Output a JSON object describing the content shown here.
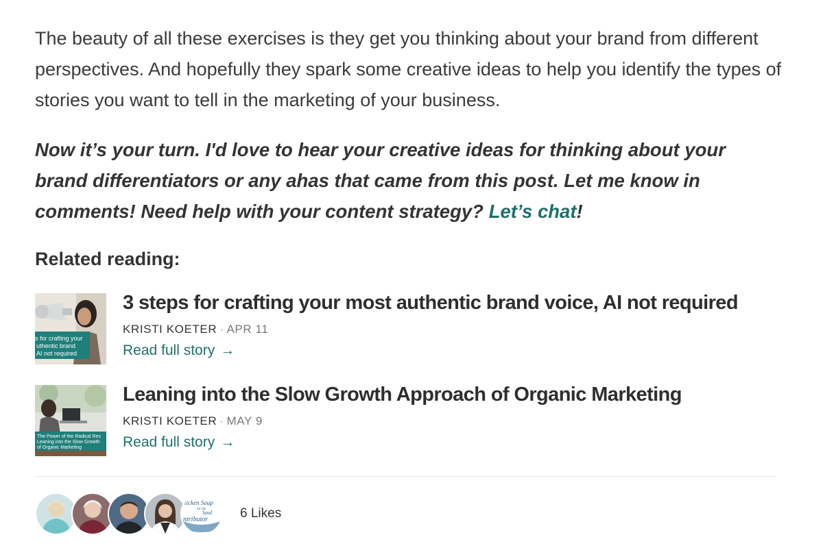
{
  "article": {
    "paragraph": "The beauty of all these exercises is they get you thinking about your brand from different perspectives. And hopefully they spark some creative ideas to help you identify the types of stories you want to tell in the marketing of your business.",
    "cta_text": "Now it’s your turn. I'd love to hear your creative ideas for thinking about your brand differentiators or any ahas that came from this post. Let me know in comments! Need help with your content strategy?",
    "cta_link": "Let’s chat",
    "cta_end": "!"
  },
  "related": {
    "heading": "Related reading:",
    "posts": [
      {
        "title": "3 steps for crafting your most authentic brand voice, AI not required",
        "author": "KRISTI KOETER",
        "separator": "·",
        "date": "APR 11",
        "link": "Read full story",
        "arrow": "→",
        "thumb_text": [
          "s for crafting your",
          "uthentic brand",
          "AI not required"
        ]
      },
      {
        "title": "Leaning into the Slow Growth Approach of Organic Marketing",
        "author": "KRISTI KOETER",
        "separator": "·",
        "date": "MAY 9",
        "link": "Read full story",
        "arrow": "→",
        "thumb_text": [
          "The Power of the Radical Res",
          "Leaning into the Slow Growth",
          "of Organic Marketing"
        ]
      }
    ]
  },
  "likes": {
    "count_label": "6 Likes",
    "avatar_logo_text": [
      "ticken Soup",
      "for the",
      "Soul",
      "ntributor"
    ]
  },
  "colors": {
    "accent": "#1f6f6a",
    "text": "#333333"
  }
}
